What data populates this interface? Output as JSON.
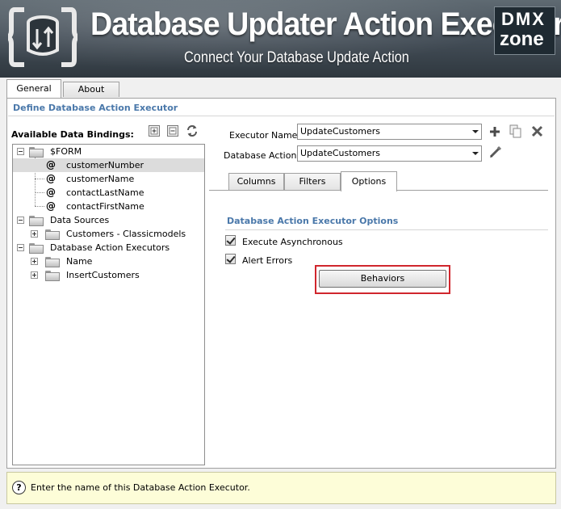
{
  "banner": {
    "title": "Database Updater Action Executor",
    "subtitle": "Connect Your Database Update Action",
    "logo_text_top": "DMX",
    "logo_text_bottom": "zone"
  },
  "top_tabs": [
    {
      "label": "General",
      "active": true
    },
    {
      "label": "About",
      "active": false
    }
  ],
  "section_title": "Define Database Action Executor",
  "bindings": {
    "label": "Available Data Bindings:",
    "toolbar_icons": [
      "expand-all-icon",
      "collapse-all-icon",
      "refresh-icon"
    ],
    "tree": [
      {
        "text": "$FORM",
        "type": "folder",
        "level": 0,
        "expander": "minus"
      },
      {
        "text": "customerNumber",
        "type": "field",
        "level": 1,
        "selected": true
      },
      {
        "text": "customerName",
        "type": "field",
        "level": 1
      },
      {
        "text": "contactLastName",
        "type": "field",
        "level": 1
      },
      {
        "text": "contactFirstName",
        "type": "field",
        "level": 1
      },
      {
        "text": "Data Sources",
        "type": "folder",
        "level": 0,
        "expander": "minus"
      },
      {
        "text": "Customers - Classicmodels",
        "type": "folder",
        "level": 1,
        "expander": "plus"
      },
      {
        "text": "Database Action Executors",
        "type": "folder",
        "level": 0,
        "expander": "minus"
      },
      {
        "text": "Name",
        "type": "folder",
        "level": 1,
        "expander": "plus"
      },
      {
        "text": "InsertCustomers",
        "type": "folder",
        "level": 1,
        "expander": "plus"
      }
    ]
  },
  "form": {
    "executor_name_label": "Executor Name:",
    "executor_name_value": "UpdateCustomers",
    "database_action_label": "Database Action:",
    "database_action_value": "UpdateCustomers",
    "executor_icons": [
      "add-icon",
      "copy-icon",
      "delete-icon"
    ],
    "action_icon": "edit-icon"
  },
  "inner_tabs": [
    {
      "label": "Columns",
      "active": false
    },
    {
      "label": "Filters",
      "active": false
    },
    {
      "label": "Options",
      "active": true
    }
  ],
  "options": {
    "title": "Database Action Executor Options",
    "execute_async_label": "Execute Asynchronous",
    "execute_async_checked": true,
    "alert_errors_label": "Alert Errors",
    "alert_errors_checked": true,
    "behaviors_button": "Behaviors"
  },
  "help": {
    "icon": "question-icon",
    "text": "Enter the name of this Database Action Executor."
  },
  "colors": {
    "section_title": "#4a78aa",
    "highlight_border": "#d0262d",
    "help_background": "#fdfdd8"
  }
}
